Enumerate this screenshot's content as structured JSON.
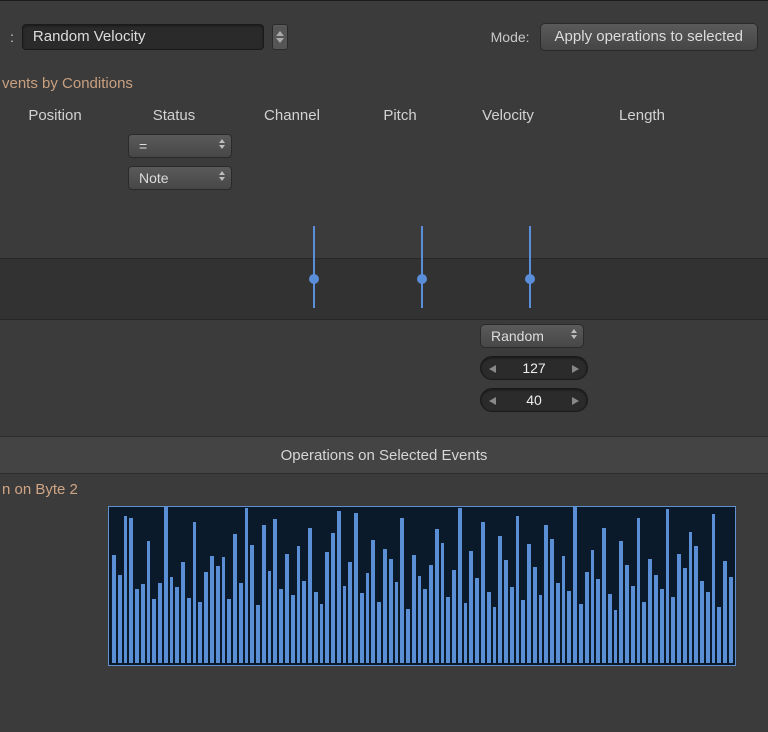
{
  "top": {
    "preset_label_cut": ":",
    "preset_value": "Random Velocity",
    "mode_label": "Mode:",
    "mode_value": "Apply operations to selected"
  },
  "conditions": {
    "title_cut": "vents by Conditions",
    "columns": {
      "position": "Position",
      "status": "Status",
      "channel": "Channel",
      "pitch": "Pitch",
      "velocity": "Velocity",
      "length": "Length"
    },
    "status_op": "=",
    "status_type": "Note"
  },
  "velocity_ops": {
    "mode": "Random",
    "max": "127",
    "min": "40"
  },
  "ops_header": "Operations on Selected Events",
  "sublabel_cut": "n on Byte 2",
  "chart_data": {
    "type": "bar",
    "title": "",
    "xlabel": "",
    "ylabel": "",
    "ylim": [
      0,
      127
    ],
    "values": [
      88,
      72,
      120,
      118,
      60,
      64,
      99,
      52,
      65,
      127,
      70,
      62,
      82,
      53,
      115,
      50,
      74,
      87,
      79,
      86,
      52,
      105,
      65,
      126,
      96,
      47,
      112,
      75,
      117,
      60,
      89,
      55,
      95,
      67,
      110,
      58,
      48,
      90,
      106,
      124,
      63,
      82,
      122,
      57,
      73,
      100,
      50,
      93,
      85,
      66,
      118,
      44,
      88,
      71,
      60,
      80,
      109,
      98,
      54,
      76,
      126,
      49,
      91,
      69,
      115,
      58,
      46,
      103,
      84,
      62,
      120,
      51,
      97,
      78,
      55,
      112,
      101,
      65,
      87,
      59,
      127,
      48,
      74,
      92,
      68,
      110,
      56,
      43,
      99,
      80,
      63,
      118,
      50,
      85,
      72,
      60,
      125,
      54,
      89,
      77,
      107,
      95,
      67,
      58,
      121,
      46,
      83,
      70
    ]
  }
}
